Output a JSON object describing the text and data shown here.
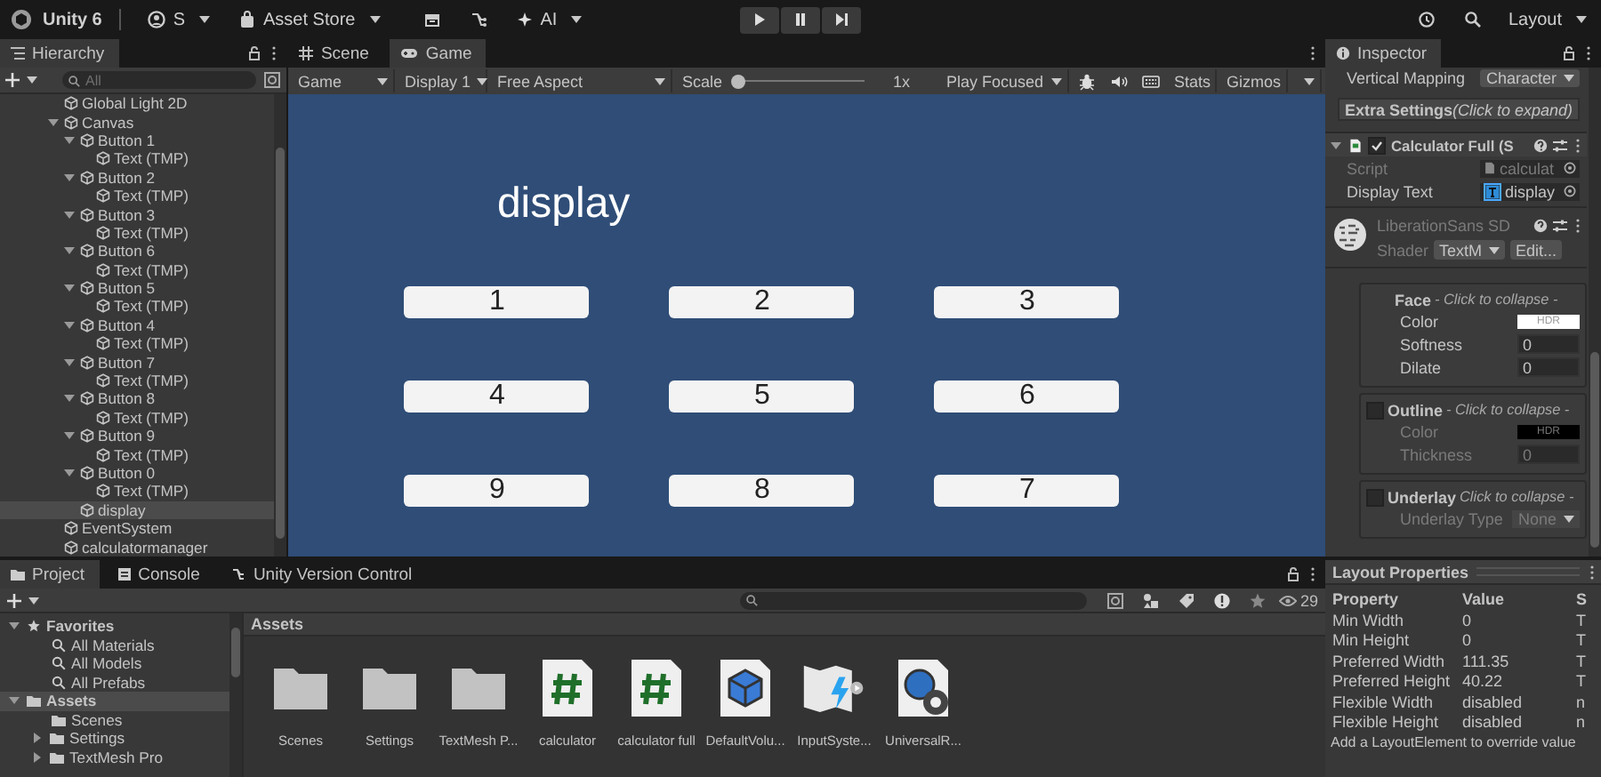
{
  "toolbar": {
    "product": "Unity 6",
    "account": "S",
    "asset_store": "Asset Store",
    "ai": "AI",
    "layout": "Layout"
  },
  "hierarchy": {
    "title": "Hierarchy",
    "search_placeholder": "All",
    "items": [
      {
        "label": "Global Light 2D",
        "selected": false
      },
      {
        "label": "Canvas",
        "selected": false,
        "expanded": true,
        "children": [
          {
            "label": "Button 1",
            "selected": false,
            "expanded": true,
            "children": [
              {
                "label": "Text (TMP)",
                "selected": false
              }
            ]
          },
          {
            "label": "Button 2",
            "selected": false,
            "expanded": true,
            "children": [
              {
                "label": "Text (TMP)",
                "selected": false
              }
            ]
          },
          {
            "label": "Button 3",
            "selected": false,
            "expanded": true,
            "children": [
              {
                "label": "Text (TMP)",
                "selected": false
              }
            ]
          },
          {
            "label": "Button 6",
            "selected": false,
            "expanded": true,
            "children": [
              {
                "label": "Text (TMP)",
                "selected": false
              }
            ]
          },
          {
            "label": "Button 5",
            "selected": false,
            "expanded": true,
            "children": [
              {
                "label": "Text (TMP)",
                "selected": false
              }
            ]
          },
          {
            "label": "Button 4",
            "selected": false,
            "expanded": true,
            "children": [
              {
                "label": "Text (TMP)",
                "selected": false
              }
            ]
          },
          {
            "label": "Button 7",
            "selected": false,
            "expanded": true,
            "children": [
              {
                "label": "Text (TMP)",
                "selected": false
              }
            ]
          },
          {
            "label": "Button 8",
            "selected": false,
            "expanded": true,
            "children": [
              {
                "label": "Text (TMP)",
                "selected": false
              }
            ]
          },
          {
            "label": "Button 9",
            "selected": false,
            "expanded": true,
            "children": [
              {
                "label": "Text (TMP)",
                "selected": false
              }
            ]
          },
          {
            "label": "Button 0",
            "selected": false,
            "expanded": true,
            "children": [
              {
                "label": "Text (TMP)",
                "selected": false
              }
            ]
          },
          {
            "label": "display",
            "selected": true
          }
        ]
      },
      {
        "label": "EventSystem",
        "selected": false
      },
      {
        "label": "calculatormanager",
        "selected": false
      }
    ]
  },
  "game_view": {
    "tabs": [
      {
        "label": "Scene",
        "selected": false
      },
      {
        "label": "Game",
        "selected": true
      }
    ],
    "toolbar": {
      "mode": "Game",
      "display": "Display 1",
      "aspect": "Free Aspect",
      "scale_label": "Scale",
      "scale": {
        "level": 0
      },
      "scale_value": "1x",
      "play_mode": "Play Focused",
      "stats": "Stats",
      "gizmos": "Gizmos"
    },
    "display_text": "display",
    "keys": [
      "1",
      "2",
      "3",
      "4",
      "5",
      "6",
      "9",
      "8",
      "7"
    ]
  },
  "inspector": {
    "title": "Inspector",
    "vertical_mapping": {
      "label": "Vertical Mapping",
      "value": "Character"
    },
    "extra_settings": {
      "label": "Extra Settings",
      "hint": "(Click to expand)"
    },
    "component": {
      "name": "Calculator Full (S",
      "enabled": true,
      "fields": [
        {
          "label": "Script",
          "value": "calculat",
          "kind": "script"
        },
        {
          "label": "Display Text",
          "value": "display",
          "kind": "object"
        }
      ]
    },
    "material": {
      "name": "LiberationSans SD",
      "shader_label": "Shader",
      "shader": "TextM",
      "edit": "Edit..."
    },
    "sections": [
      {
        "kind": "plain",
        "title": "Face",
        "hint": "- Click to collapse -",
        "fields": [
          {
            "kind": "color",
            "label": "Color",
            "value": "HDR",
            "color": "#ffffff",
            "disabled": false
          },
          {
            "kind": "number",
            "label": "Softness",
            "value": "0",
            "disabled": false
          },
          {
            "kind": "number",
            "label": "Dilate",
            "value": "0",
            "disabled": false
          }
        ]
      },
      {
        "kind": "toggle",
        "enabled": false,
        "title": "Outline",
        "hint": "- Click to collapse -",
        "fields": [
          {
            "kind": "color",
            "label": "Color",
            "value": "HDR",
            "color": "#000000",
            "disabled": true
          },
          {
            "kind": "number",
            "label": "Thickness",
            "value": "0",
            "disabled": true
          }
        ]
      },
      {
        "kind": "toggle",
        "enabled": false,
        "title": "Underlay",
        "hint": "Click to collapse -",
        "fields": [
          {
            "kind": "dropdown",
            "label": "Underlay Type",
            "value": "None",
            "disabled": true
          }
        ]
      }
    ]
  },
  "project": {
    "tabs": [
      {
        "label": "Project",
        "selected": true
      },
      {
        "label": "Console",
        "selected": false
      },
      {
        "label": "Unity Version Control",
        "selected": false
      }
    ],
    "count": "29",
    "sidebar": [
      {
        "label": "Favorites",
        "kind": "favorites",
        "expanded": true,
        "selected": false,
        "children": [
          {
            "label": "All Materials",
            "kind": "search",
            "selected": false
          },
          {
            "label": "All Models",
            "kind": "search",
            "selected": false
          },
          {
            "label": "All Prefabs",
            "kind": "search",
            "selected": false
          }
        ]
      },
      {
        "label": "Assets",
        "kind": "folder",
        "expanded": true,
        "selected": true,
        "children": [
          {
            "label": "Scenes",
            "kind": "folder",
            "selected": false
          },
          {
            "label": "Settings",
            "kind": "folder",
            "expanded": false,
            "selected": false
          },
          {
            "label": "TextMesh Pro",
            "kind": "folder",
            "expanded": false,
            "selected": false
          }
        ]
      }
    ],
    "breadcrumb": "Assets",
    "assets": [
      {
        "label": "Scenes",
        "kind": "folder"
      },
      {
        "label": "Settings",
        "kind": "folder"
      },
      {
        "label": "TextMesh P...",
        "kind": "folder"
      },
      {
        "label": "calculator",
        "kind": "script"
      },
      {
        "label": "calculator full",
        "kind": "script"
      },
      {
        "label": "DefaultVolu...",
        "kind": "volume"
      },
      {
        "label": "InputSyste...",
        "kind": "input"
      },
      {
        "label": "UniversalR...",
        "kind": "pipeline"
      }
    ]
  },
  "layout_properties": {
    "title": "Layout Properties",
    "columns": [
      "Property",
      "Value",
      "S"
    ],
    "rows": [
      [
        "Min Width",
        "0",
        "T"
      ],
      [
        "Min Height",
        "0",
        "T"
      ],
      [
        "Preferred Width",
        "111.35",
        "T"
      ],
      [
        "Preferred Height",
        "40.22",
        "T"
      ],
      [
        "Flexible Width",
        "disabled",
        "n"
      ],
      [
        "Flexible Height",
        "disabled",
        "n"
      ]
    ],
    "footer": "Add a LayoutElement to override value"
  }
}
